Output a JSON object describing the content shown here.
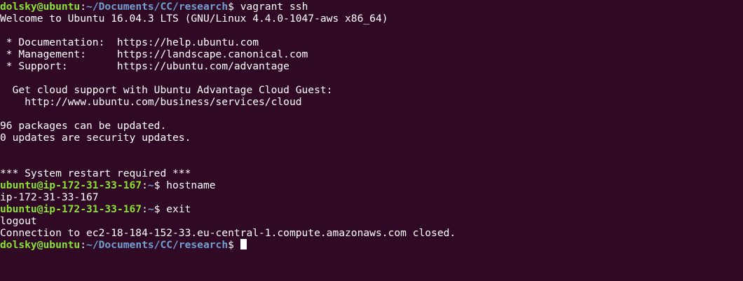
{
  "terminal": {
    "background": "#300a24",
    "prompt_user_color": "#8ae234",
    "prompt_path_color": "#729fcf",
    "lines": [
      {
        "kind": "prompt",
        "user": "dolsky@ubuntu",
        "sep": ":",
        "path": "~/Documents/CC/research",
        "sym": "$ ",
        "cmd": "vagrant ssh"
      },
      {
        "kind": "text",
        "text": "Welcome to Ubuntu 16.04.3 LTS (GNU/Linux 4.4.0-1047-aws x86_64)"
      },
      {
        "kind": "text",
        "text": ""
      },
      {
        "kind": "text",
        "text": " * Documentation:  https://help.ubuntu.com"
      },
      {
        "kind": "text",
        "text": " * Management:     https://landscape.canonical.com"
      },
      {
        "kind": "text",
        "text": " * Support:        https://ubuntu.com/advantage"
      },
      {
        "kind": "text",
        "text": ""
      },
      {
        "kind": "text",
        "text": "  Get cloud support with Ubuntu Advantage Cloud Guest:"
      },
      {
        "kind": "text",
        "text": "    http://www.ubuntu.com/business/services/cloud"
      },
      {
        "kind": "text",
        "text": ""
      },
      {
        "kind": "text",
        "text": "96 packages can be updated."
      },
      {
        "kind": "text",
        "text": "0 updates are security updates."
      },
      {
        "kind": "text",
        "text": ""
      },
      {
        "kind": "text",
        "text": ""
      },
      {
        "kind": "text",
        "text": "*** System restart required ***"
      },
      {
        "kind": "prompt",
        "user": "ubuntu@ip-172-31-33-167",
        "sep": ":",
        "path": "~",
        "sym": "$ ",
        "cmd": "hostname"
      },
      {
        "kind": "text",
        "text": "ip-172-31-33-167"
      },
      {
        "kind": "prompt",
        "user": "ubuntu@ip-172-31-33-167",
        "sep": ":",
        "path": "~",
        "sym": "$ ",
        "cmd": "exit"
      },
      {
        "kind": "text",
        "text": "logout"
      },
      {
        "kind": "text",
        "text": "Connection to ec2-18-184-152-33.eu-central-1.compute.amazonaws.com closed."
      },
      {
        "kind": "prompt",
        "user": "dolsky@ubuntu",
        "sep": ":",
        "path": "~/Documents/CC/research",
        "sym": "$ ",
        "cmd": "",
        "cursor": true
      }
    ]
  }
}
